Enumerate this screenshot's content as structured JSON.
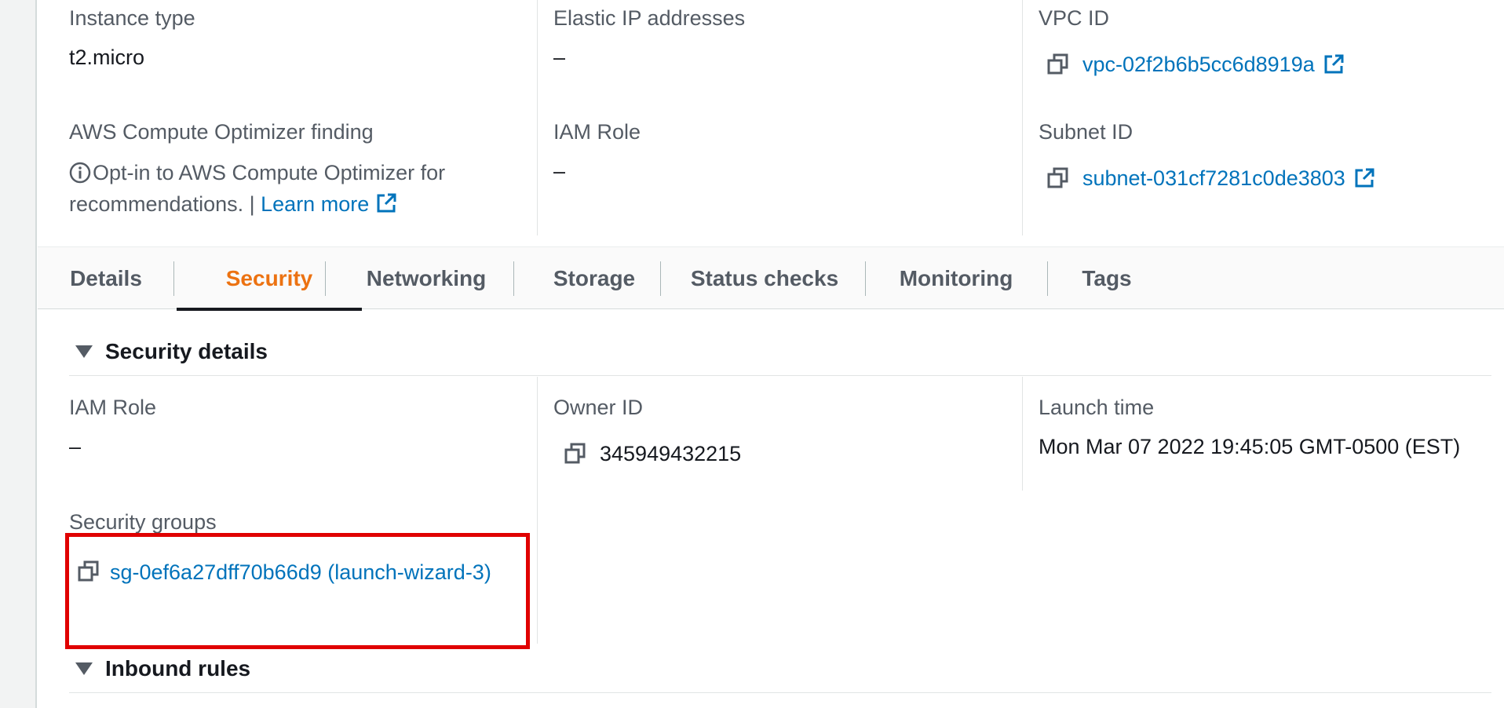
{
  "top_fields": {
    "instance_type": {
      "label": "Instance type",
      "value": "t2.micro"
    },
    "elastic_ip": {
      "label": "Elastic IP addresses",
      "value": "–"
    },
    "vpc_id": {
      "label": "VPC ID",
      "value": "vpc-02f2b6b5cc6d8919a"
    },
    "optimizer": {
      "label": "AWS Compute Optimizer finding",
      "text": "Opt-in to AWS Compute Optimizer for recommendations. |",
      "link": "Learn more"
    },
    "iam_role": {
      "label": "IAM Role",
      "value": "–"
    },
    "subnet_id": {
      "label": "Subnet ID",
      "value": "subnet-031cf7281c0de3803"
    }
  },
  "tabs": [
    {
      "label": "Details"
    },
    {
      "label": "Security"
    },
    {
      "label": "Networking"
    },
    {
      "label": "Storage"
    },
    {
      "label": "Status checks"
    },
    {
      "label": "Monitoring"
    },
    {
      "label": "Tags"
    }
  ],
  "active_tab": "Security",
  "security_details": {
    "header": "Security details",
    "iam_role": {
      "label": "IAM Role",
      "value": "–"
    },
    "owner_id": {
      "label": "Owner ID",
      "value": "345949432215"
    },
    "launch_time": {
      "label": "Launch time",
      "value": "Mon Mar 07 2022 19:45:05 GMT-0500 (EST)"
    },
    "security_groups": {
      "label": "Security groups",
      "value": "sg-0ef6a27dff70b66d9 (launch-wizard-3)"
    }
  },
  "inbound_rules": {
    "header": "Inbound rules"
  },
  "colors": {
    "link": "#0073bb",
    "active_tab": "#ec7211",
    "highlight": "#e00000",
    "label": "#545b64"
  }
}
